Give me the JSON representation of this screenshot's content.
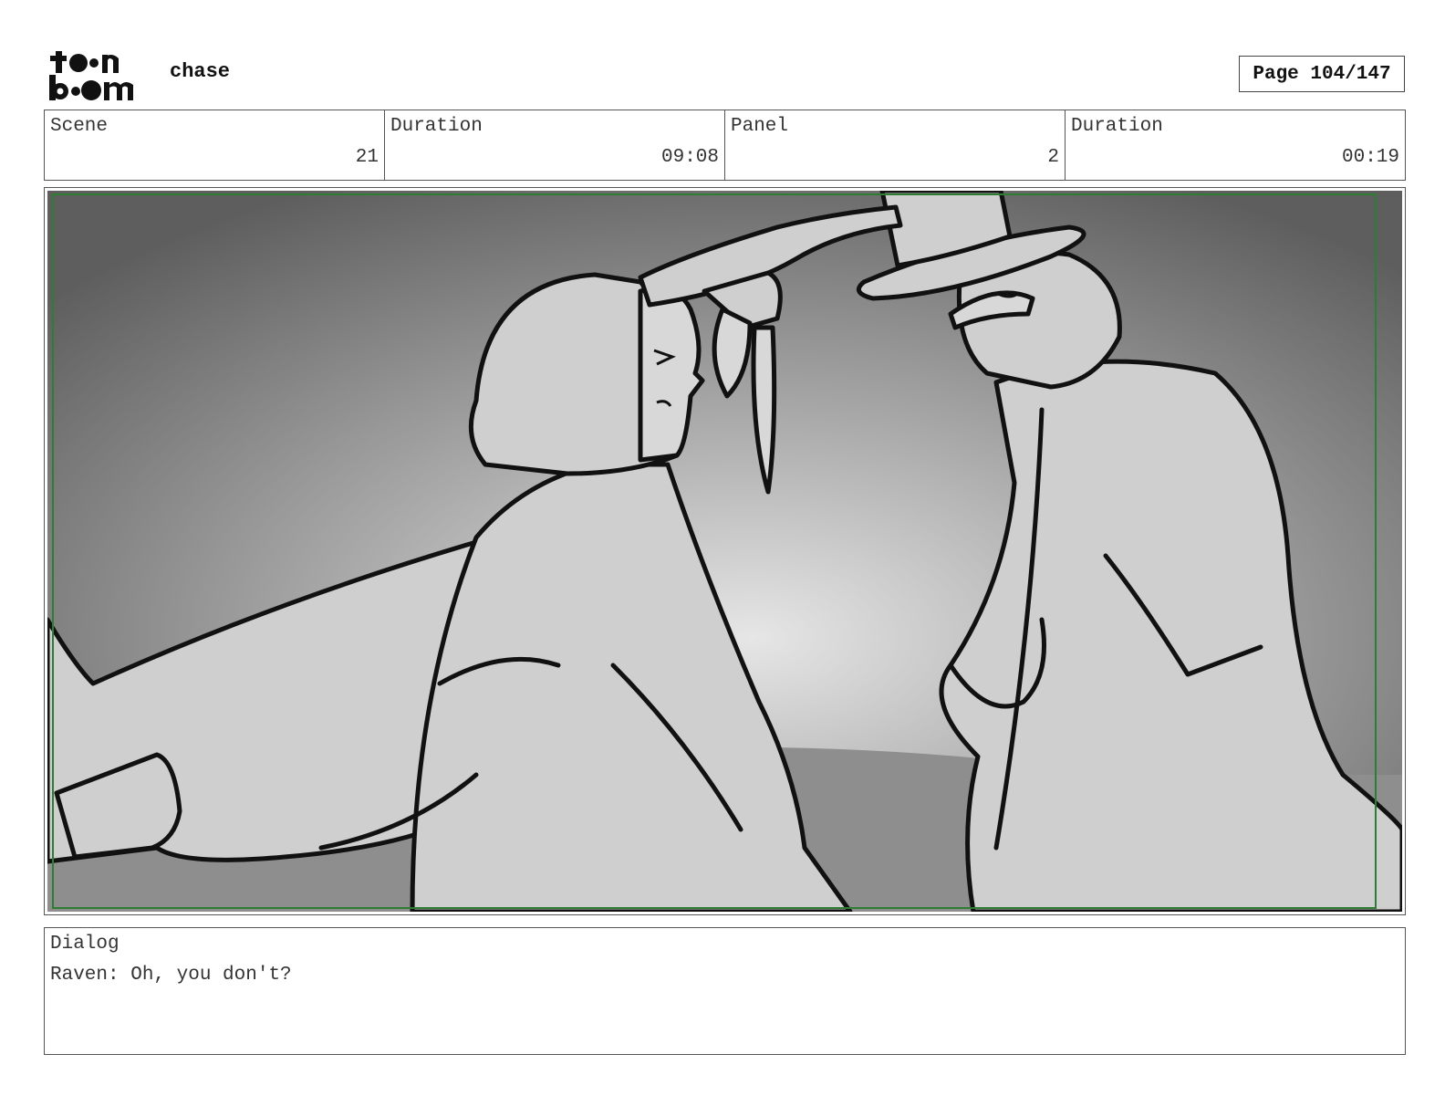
{
  "header": {
    "logo_text": "toon boom",
    "project_title": "chase",
    "page_label": "Page 104/147"
  },
  "info": {
    "scene_label": "Scene",
    "scene_value": "21",
    "scene_duration_label": "Duration",
    "scene_duration_value": "09:08",
    "panel_label": "Panel",
    "panel_value": "2",
    "panel_duration_label": "Duration",
    "panel_duration_value": "00:19"
  },
  "dialog": {
    "label": "Dialog",
    "text": "Raven: Oh, you don't?"
  },
  "colors": {
    "safe_frame": "#2e7d32",
    "sketch_line": "#111111",
    "figure_fill": "#cfcfcf"
  }
}
